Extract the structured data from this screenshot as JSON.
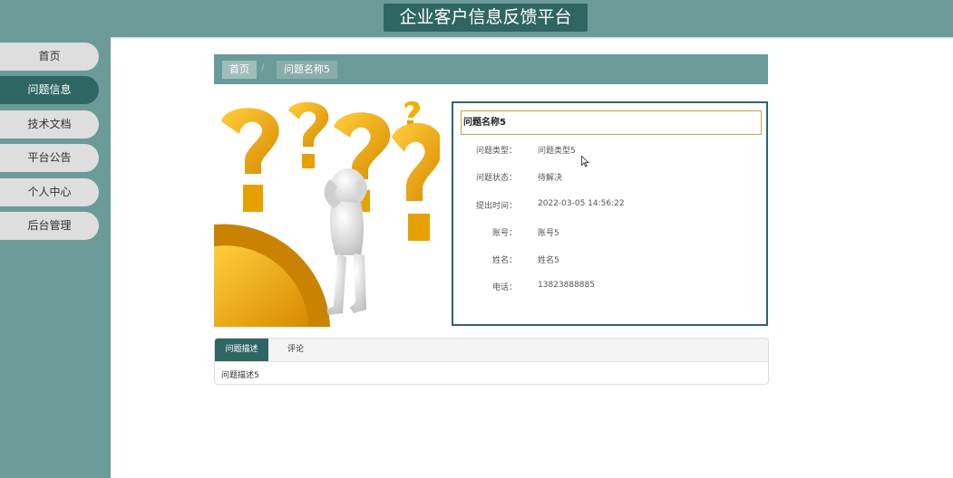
{
  "header": {
    "title": "企业客户信息反馈平台"
  },
  "nav": {
    "items": [
      {
        "label": "首页"
      },
      {
        "label": "问题信息",
        "active": true
      },
      {
        "label": "技术文档"
      },
      {
        "label": "平台公告"
      },
      {
        "label": "个人中心"
      },
      {
        "label": "后台管理"
      }
    ]
  },
  "breadcrumb": {
    "home": "首页",
    "separator": "/",
    "current": "问题名称5"
  },
  "detail": {
    "title": "问题名称5",
    "rows": [
      {
        "label": "问题类型：",
        "value": "问题类型5"
      },
      {
        "label": "问题状态：",
        "value": "待解决"
      },
      {
        "label": "提出时间：",
        "value": "2022-03-05 14:56:22"
      },
      {
        "label": "账号：",
        "value": "账号5"
      },
      {
        "label": "姓名：",
        "value": "姓名5"
      },
      {
        "label": "电话：",
        "value": "13823888885"
      }
    ]
  },
  "tabs": {
    "items": [
      {
        "label": "问题描述"
      },
      {
        "label": "评论"
      }
    ],
    "content": "问题描述5"
  },
  "colors": {
    "teal": "#6a9b98",
    "dark_teal": "#2f6664",
    "gold": "#c8a24c"
  }
}
